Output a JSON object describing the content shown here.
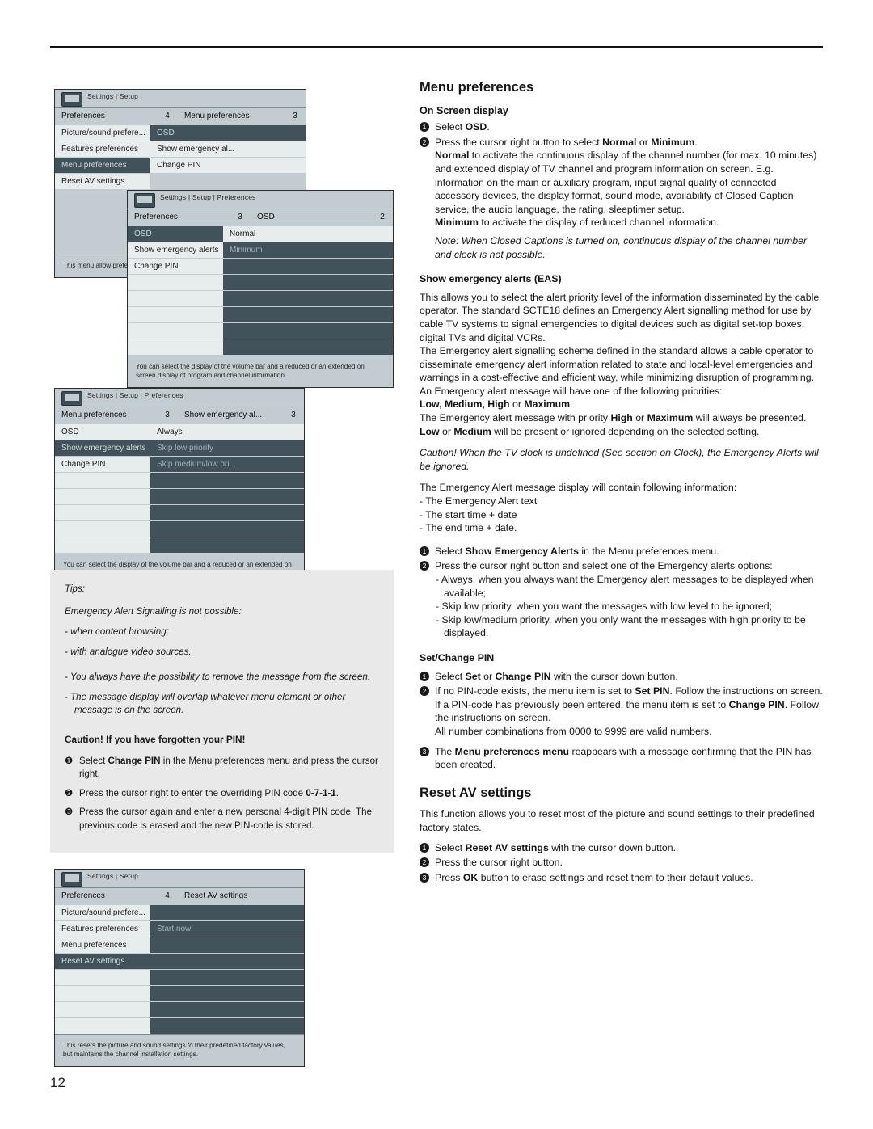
{
  "page": {
    "number": "12"
  },
  "osd_screens": [
    {
      "id": "settings-setup-1",
      "breadcrumb": "Settings | Setup",
      "head": {
        "left": "Preferences",
        "left_num": "4",
        "right": "Menu preferences",
        "right_num": "3"
      },
      "left_items": [
        "Picture/sound prefere...",
        "Features preferences",
        "Menu preferences",
        "Reset AV settings"
      ],
      "right_items": [
        "OSD",
        "Show emergency al...",
        "Change PIN"
      ],
      "note": "This menu allow preferences."
    },
    {
      "id": "settings-setup-preferences-osd",
      "breadcrumb": "Settings | Setup | Preferences",
      "head": {
        "left": "Preferences",
        "left_num": "3",
        "right": "OSD",
        "right_num": "2"
      },
      "left_items": [
        "OSD",
        "Show emergency alerts",
        "Change PIN"
      ],
      "right_items": [
        "Normal",
        "Minimum"
      ],
      "note": "You can select the display of the volume bar and a reduced or an extended on screen display of program and channel information."
    },
    {
      "id": "settings-setup-preferences-eas",
      "breadcrumb": "Settings | Setup | Preferences",
      "head": {
        "left": "Menu preferences",
        "left_num": "3",
        "right": "Show emergency al...",
        "right_num": "3"
      },
      "left_items": [
        "OSD",
        "Show emergency alerts",
        "Change PIN"
      ],
      "right_items": [
        "Always",
        "Skip low priority",
        "Skip medium/low pri..."
      ],
      "note": "You can select the display of the volume bar and a reduced or an extended on screen display of program and channel information."
    },
    {
      "id": "settings-setup-reset-av",
      "breadcrumb": "Settings | Setup",
      "head": {
        "left": "Preferences",
        "left_num": "4",
        "right": "Reset AV settings",
        "right_num": ""
      },
      "left_items": [
        "Picture/sound prefere...",
        "Features preferences",
        "Menu preferences",
        "Reset AV settings"
      ],
      "right_items": [
        "",
        "Start now",
        ""
      ],
      "note": "This resets the picture and sound settings to their predefined factory values, but maintains the channel installation settings."
    }
  ],
  "tips": {
    "heading": "Tips:",
    "line1": "Emergency Alert Signalling is not possible:",
    "bullets": [
      "- when content browsing;",
      "- with analogue video sources."
    ],
    "items": [
      "- You always have the possibility to remove the message from the screen.",
      "- The message display will overlap whatever menu element or other message is on the screen."
    ]
  },
  "caution_pin": {
    "heading": "Caution! If you have forgotten your PIN!",
    "steps": [
      {
        "num": "❶",
        "text_html": "Select <b>Change PIN</b> in the Menu preferences menu and press the cursor right."
      },
      {
        "num": "❷",
        "text_html": "Press the cursor right to enter the overriding PIN code <b>0-7-1-1</b>."
      },
      {
        "num": "❸",
        "text_html": "Press the cursor again and enter a new personal 4-digit PIN code. The previous code is erased and the new PIN-code is stored."
      }
    ]
  },
  "right": {
    "title": "Menu preferences",
    "osd": {
      "heading": "On Screen display",
      "step1": "Select <b>OSD</b>.",
      "step2": "Press the cursor right button to select <b>Normal</b> or <b>Minimum</b>.",
      "normal": "<b>Normal</b> to activate the continuous display of the channel number (for max. 10 minutes) and extended display of TV channel and program information on screen. E.g. information on the main or auxiliary program, input signal quality of connected accessory devices, the display format, sound mode, availability of Closed Caption service, the audio language, the rating, sleeptimer setup.",
      "minimum": "<b>Minimum</b> to activate the display of reduced channel information.",
      "note": "Note: When Closed Captions is turned on, continuous display of the channel number and clock is not possible."
    },
    "eas": {
      "heading": "Show emergency alerts (EAS)",
      "p1": "This allows you to select the alert priority level of the information disseminated by the cable operator. The standard SCTE18 defines an Emergency Alert signalling method for use by cable TV systems to signal emergencies to digital devices such as digital set-top boxes, digital TVs and digital VCRs.",
      "p2": "The Emergency alert signalling scheme defined in the standard allows a cable operator to disseminate emergency alert information related to state and local-level emergencies and warnings in a cost-effective and efficient way, while minimizing disruption of programming.",
      "p3": "An Emergency alert message will have one of the following priorities:",
      "priorities": "<b>Low, Medium, High</b> or <b>Maximum</b>.",
      "p4": "The Emergency alert message with priority <b>High</b> or <b>Maximum</b> will always be presented. <b>Low</b> or <b>Medium</b> will be present or ignored depending on the selected setting.",
      "caution": "Caution! When the TV clock is undefined (See section on Clock), the Emergency Alerts will be ignored.",
      "p5": "The Emergency Alert message display will contain following information:",
      "contains": [
        "- The Emergency Alert text",
        "- The start time + date",
        "- The end time + date."
      ],
      "step1": "Select <b>Show Emergency Alerts</b> in the Menu preferences menu.",
      "step2": "Press the cursor right button and select one of the Emergency alerts options:",
      "options": [
        "- Always, when you always want the Emergency alert messages to be displayed when available;",
        "- Skip low priority, when you want the messages with low level to be ignored;",
        "- Skip low/medium priority, when you only want the messages with high priority to be displayed."
      ]
    },
    "pin": {
      "heading": "Set/Change PIN",
      "step1": "Select <b>Set</b> or <b>Change PIN</b> with the cursor down button.",
      "step2": "If no PIN-code exists, the menu item is set to <b>Set PIN</b>. Follow the instructions on screen.",
      "step2b": "If a PIN-code has previously been entered, the menu item is set to <b>Change PIN</b>. Follow the instructions on screen.",
      "step2c": "All number combinations from 0000 to 9999 are valid numbers.",
      "step3": "The <b>Menu preferences menu</b> reappears with a message confirming that the PIN has been created."
    },
    "reset": {
      "heading": "Reset AV settings",
      "p1": "This function allows you to reset most of the picture and sound settings to their predefined factory states.",
      "step1": "Select <b>Reset AV settings</b> with the cursor down button.",
      "step2": "Press the cursor right button.",
      "step3": "Press <b>OK</b> button to erase settings and reset them to their default values."
    }
  }
}
